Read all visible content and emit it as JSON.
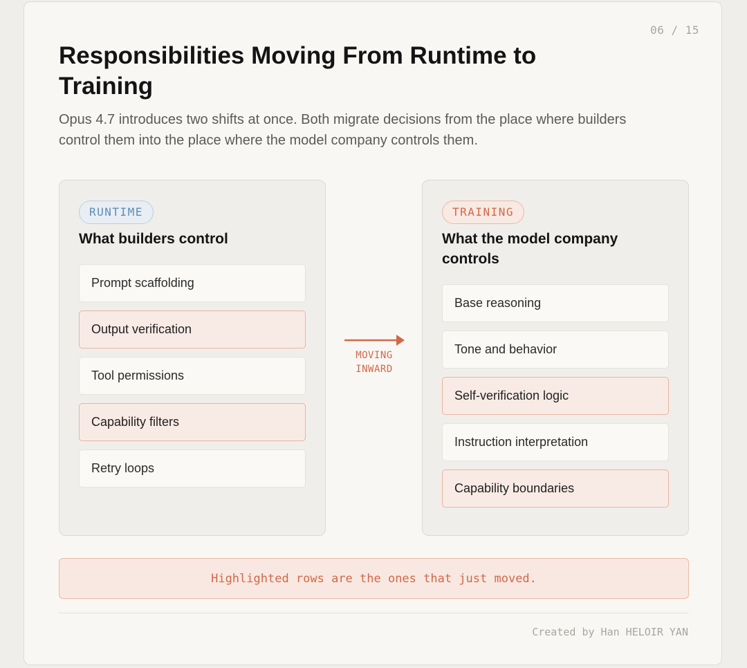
{
  "page": {
    "counter": "06 / 15",
    "title": "Responsibilities Moving From Runtime to Training",
    "subtitle": "Opus 4.7 introduces two shifts at once. Both migrate decisions from the place where builders control them into the place where the model company controls them."
  },
  "runtime_panel": {
    "tag": "RUNTIME",
    "heading": "What builders control",
    "items": [
      {
        "label": "Prompt scaffolding",
        "highlighted": false
      },
      {
        "label": "Output verification",
        "highlighted": true
      },
      {
        "label": "Tool permissions",
        "highlighted": false
      },
      {
        "label": "Capability filters",
        "highlighted": true
      },
      {
        "label": "Retry loops",
        "highlighted": false
      }
    ]
  },
  "connector": {
    "line1": "MOVING",
    "line2": "INWARD",
    "direction_icon": "arrow-right-icon"
  },
  "training_panel": {
    "tag": "TRAINING",
    "heading": "What the model company controls",
    "items": [
      {
        "label": "Base reasoning",
        "highlighted": false
      },
      {
        "label": "Tone and behavior",
        "highlighted": false
      },
      {
        "label": "Self-verification logic",
        "highlighted": true
      },
      {
        "label": "Instruction interpretation",
        "highlighted": false
      },
      {
        "label": "Capability boundaries",
        "highlighted": true
      }
    ]
  },
  "note": "Highlighted rows are the ones that just moved.",
  "credit": "Created by Han HELOIR YAN",
  "colors": {
    "accent": "#d0694a",
    "runtime_tag": "#5d8db6",
    "highlight_fill": "#f8ebe5",
    "highlight_border": "#eab3a0"
  }
}
